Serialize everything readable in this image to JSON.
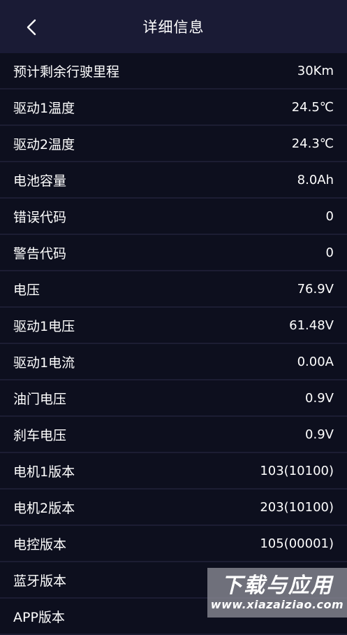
{
  "header": {
    "title": "详细信息",
    "back_icon": "chevron-left-icon"
  },
  "rows": [
    {
      "label": "预计剩余行驶里程",
      "value": "30Km"
    },
    {
      "label": "驱动1温度",
      "value": "24.5℃"
    },
    {
      "label": "驱动2温度",
      "value": "24.3℃"
    },
    {
      "label": "电池容量",
      "value": "8.0Ah"
    },
    {
      "label": "错误代码",
      "value": "0"
    },
    {
      "label": "警告代码",
      "value": "0"
    },
    {
      "label": "电压",
      "value": "76.9V"
    },
    {
      "label": "驱动1电压",
      "value": "61.48V"
    },
    {
      "label": "驱动1电流",
      "value": "0.00A"
    },
    {
      "label": "油门电压",
      "value": "0.9V"
    },
    {
      "label": "刹车电压",
      "value": "0.9V"
    },
    {
      "label": "电机1版本",
      "value": "103(10100)"
    },
    {
      "label": "电机2版本",
      "value": "203(10100)"
    },
    {
      "label": "电控版本",
      "value": "105(00001)"
    },
    {
      "label": "蓝牙版本",
      "value": ""
    },
    {
      "label": "APP版本",
      "value": ""
    }
  ],
  "watermark": {
    "main": "下载与应用",
    "sub": "www.xiazaiziao.com"
  },
  "colors": {
    "background": "#0d0f1e",
    "header": "#1a1b35",
    "divider": "#1c1d33",
    "text": "#ffffff"
  }
}
